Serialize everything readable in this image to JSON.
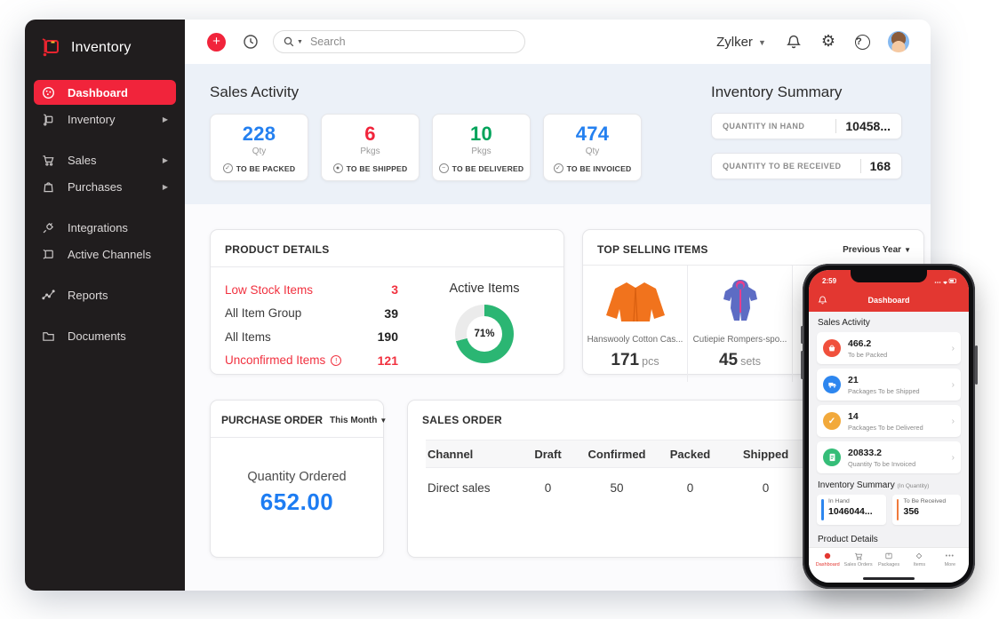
{
  "app": {
    "name": "Inventory"
  },
  "sidebar": {
    "items": [
      {
        "label": "Dashboard",
        "icon": "dashboard-icon",
        "active": true
      },
      {
        "label": "Inventory",
        "icon": "handtruck-icon",
        "arrow": true
      },
      {
        "label": "Sales",
        "icon": "cart-icon",
        "arrow": true
      },
      {
        "label": "Purchases",
        "icon": "bag-icon",
        "arrow": true
      },
      {
        "label": "Integrations",
        "icon": "plug-icon"
      },
      {
        "label": "Active Channels",
        "icon": "channels-icon"
      },
      {
        "label": "Reports",
        "icon": "chart-icon"
      },
      {
        "label": "Documents",
        "icon": "folder-icon"
      }
    ]
  },
  "topbar": {
    "search_placeholder": "Search",
    "org_name": "Zylker"
  },
  "colors": {
    "accent_red": "#f1243b",
    "number_blue": "#2480f0",
    "number_red": "#f1243b",
    "number_green": "#00a35a",
    "donut_green": "#2bb673",
    "po_blue": "#1d7cf2",
    "phone_red": "#e33731"
  },
  "sales_activity": {
    "title": "Sales Activity",
    "cards": [
      {
        "value": "228",
        "unit": "Qty",
        "label": "TO BE PACKED",
        "color": "#2480f0"
      },
      {
        "value": "6",
        "unit": "Pkgs",
        "label": "TO BE SHIPPED",
        "color": "#f1243b"
      },
      {
        "value": "10",
        "unit": "Pkgs",
        "label": "TO BE DELIVERED",
        "color": "#00a35a"
      },
      {
        "value": "474",
        "unit": "Qty",
        "label": "TO BE INVOICED",
        "color": "#2480f0"
      }
    ]
  },
  "inventory_summary": {
    "title": "Inventory Summary",
    "rows": [
      {
        "label": "QUANTITY IN HAND",
        "value": "10458..."
      },
      {
        "label": "QUANTITY TO BE RECEIVED",
        "value": "168"
      }
    ]
  },
  "product_details": {
    "title": "PRODUCT DETAILS",
    "rows": [
      {
        "label": "Low Stock Items",
        "value": "3",
        "alert": true
      },
      {
        "label": "All Item Group",
        "value": "39"
      },
      {
        "label": "All Items",
        "value": "190"
      },
      {
        "label": "Unconfirmed Items",
        "value": "121",
        "alert": true,
        "info": true
      }
    ],
    "chart": {
      "label": "Active Items",
      "percent": 71,
      "percent_label": "71%",
      "type": "donut"
    }
  },
  "top_selling": {
    "title": "TOP SELLING ITEMS",
    "period": "Previous Year",
    "items": [
      {
        "name": "Hanswooly Cotton Cas...",
        "qty": "171",
        "unit": "pcs"
      },
      {
        "name": "Cutiepie Rompers-spo...",
        "qty": "45",
        "unit": "sets"
      }
    ]
  },
  "purchase_order": {
    "title": "PURCHASE ORDER",
    "period": "This Month",
    "label": "Quantity Ordered",
    "value": "652.00"
  },
  "sales_order": {
    "title": "SALES ORDER",
    "columns": [
      "Channel",
      "Draft",
      "Confirmed",
      "Packed",
      "Shipped"
    ],
    "rows": [
      {
        "channel": "Direct sales",
        "draft": "0",
        "confirmed": "50",
        "packed": "0",
        "shipped": "0"
      }
    ]
  },
  "phone": {
    "time": "2:59",
    "header": "Dashboard",
    "sales_activity_title": "Sales Activity",
    "items": [
      {
        "value": "466.2",
        "label": "To be Packed",
        "icon": "basket-icon",
        "color": "#f0503c"
      },
      {
        "value": "21",
        "label": "Packages To be Shipped",
        "icon": "truck-icon",
        "color": "#2d86ef"
      },
      {
        "value": "14",
        "label": "Packages To be Delivered",
        "icon": "check-icon",
        "color": "#f2a93b"
      },
      {
        "value": "20833.2",
        "label": "Quantity To be Invoiced",
        "icon": "invoice-icon",
        "color": "#35bd78"
      }
    ],
    "summary_title": "Inventory Summary",
    "summary_suffix": "(In Quantity)",
    "summary_cards": [
      {
        "label": "In Hand",
        "value": "1046044...",
        "accent": "#2d86ef"
      },
      {
        "label": "To Be Received",
        "value": "356",
        "accent": "#f07a3c"
      }
    ],
    "product_details_title": "Product Details",
    "tabs": [
      {
        "label": "Dashboard",
        "icon": "dashboard-icon",
        "active": true
      },
      {
        "label": "Sales Orders",
        "icon": "cart-icon"
      },
      {
        "label": "Packages",
        "icon": "package-icon"
      },
      {
        "label": "Items",
        "icon": "items-icon"
      },
      {
        "label": "More",
        "icon": "more-icon"
      }
    ]
  }
}
